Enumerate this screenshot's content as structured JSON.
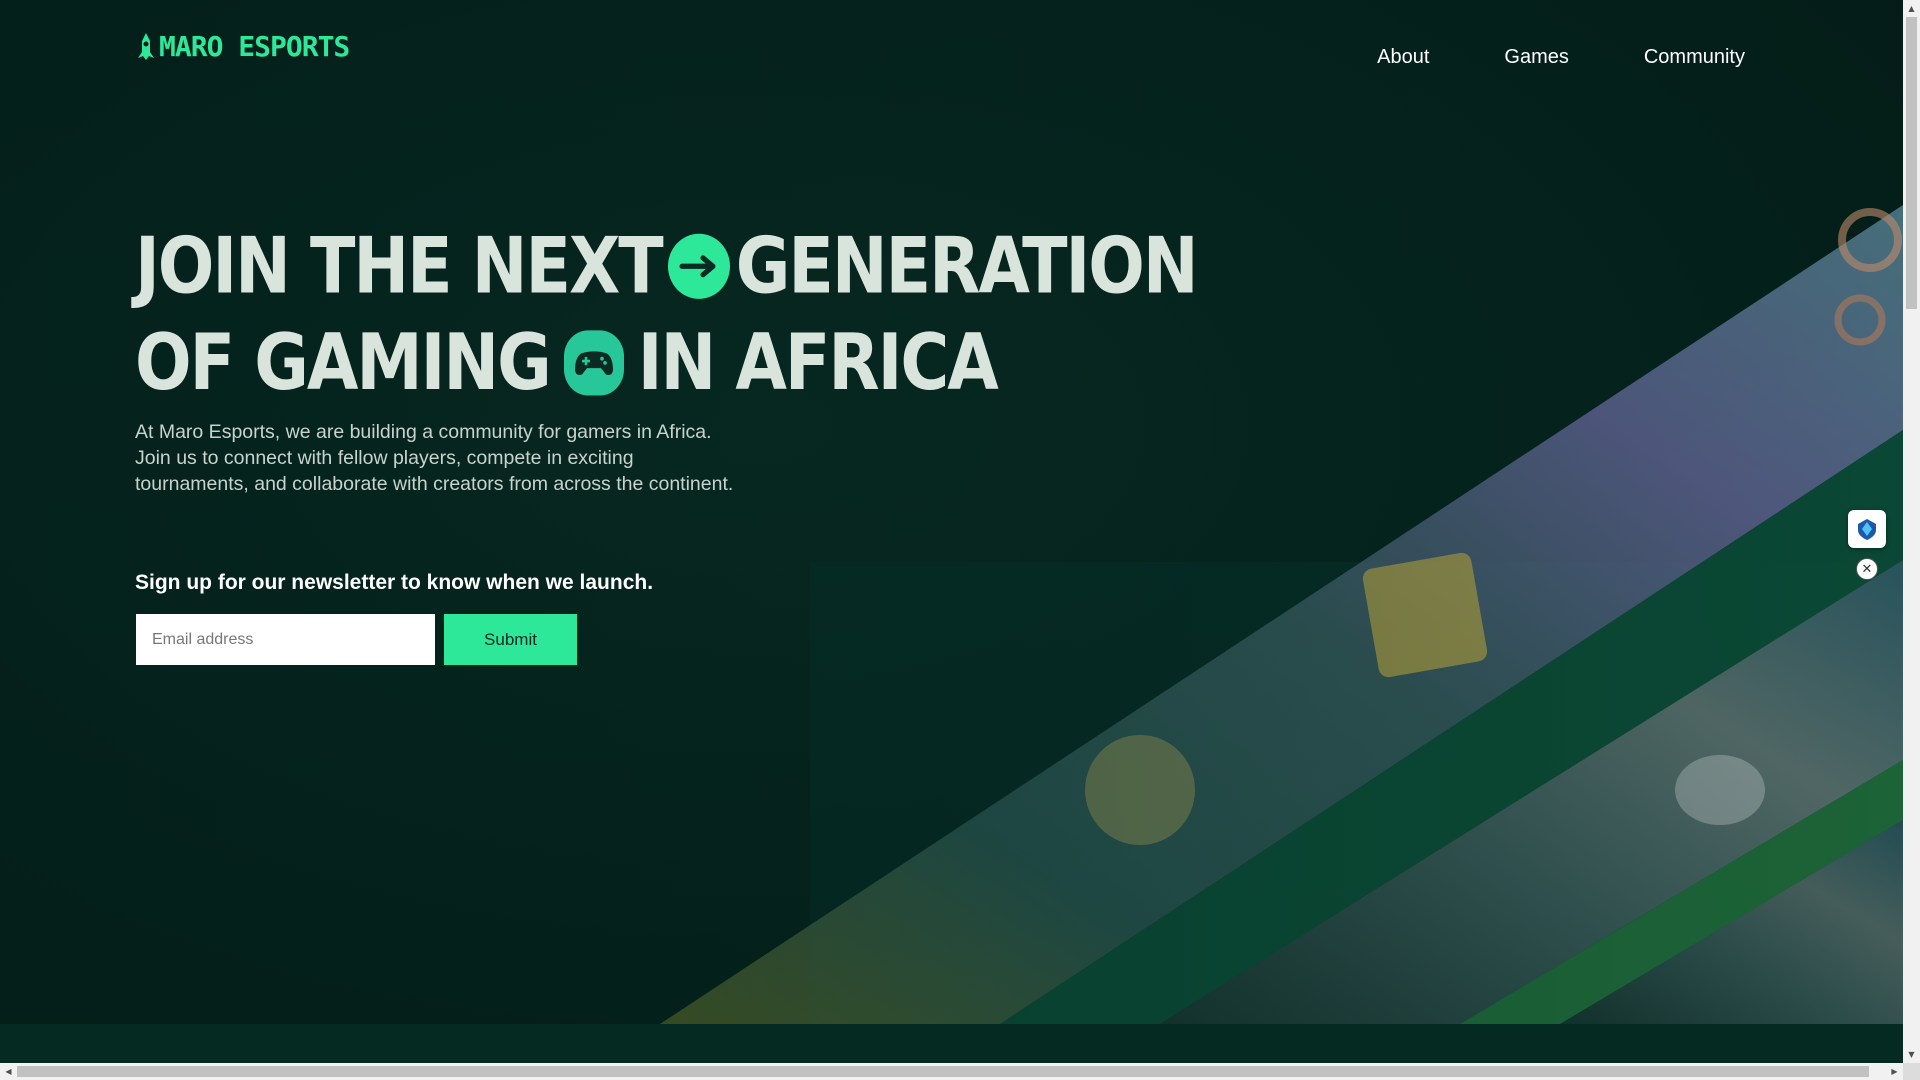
{
  "brand": {
    "name": "MARO ESPORTS",
    "color": "#2ee89a"
  },
  "nav": {
    "items": [
      {
        "label": "About"
      },
      {
        "label": "Games"
      },
      {
        "label": "Community"
      }
    ]
  },
  "hero": {
    "title_line1_a": "JOIN THE NEXT",
    "title_line1_b": "GENERATION",
    "title_line2_a": "OF GAMING",
    "title_line2_b": "IN AFRICA",
    "icons": [
      "arrow-right-icon",
      "gamepad-icon"
    ],
    "description": "At Maro Esports, we are building a community for gamers in Africa. Join us to connect with fellow players, compete in exciting tournaments, and collaborate with creators from across the continent."
  },
  "newsletter": {
    "label": "Sign up for our newsletter to know when we launch.",
    "email_placeholder": "Email address",
    "email_value": "",
    "submit_label": "Submit"
  },
  "floating": {
    "extension_icon": "shield-gem-icon",
    "close_icon": "close-icon",
    "close_glyph": "✕"
  },
  "colors": {
    "background": "#041f1a",
    "accent": "#2ee89a",
    "title_text": "#d9e4dd"
  }
}
